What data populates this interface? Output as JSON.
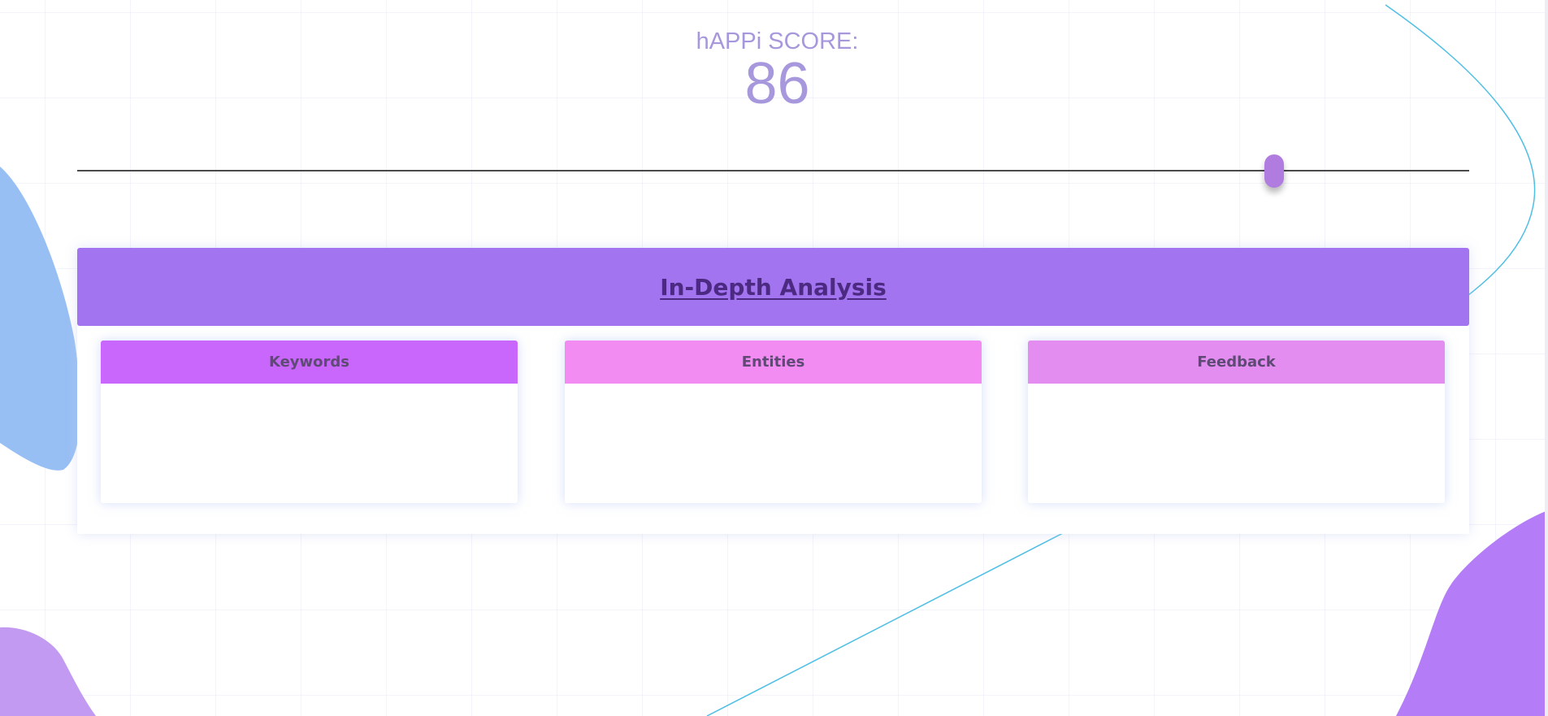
{
  "score": {
    "label": "hAPPi SCORE:",
    "value": "86"
  },
  "slider": {
    "value": 86,
    "min": 0,
    "max": 100
  },
  "analysis": {
    "title": "In-Depth Analysis",
    "cards": [
      {
        "label": "Keywords",
        "color": "#c966fb"
      },
      {
        "label": "Entities",
        "color": "#f28bf2"
      },
      {
        "label": "Feedback",
        "color": "#e38df0"
      }
    ]
  },
  "colors": {
    "score_text": "#a797dc",
    "header": "#a374f0",
    "slider_thumb": "#b07cdf",
    "blob_blue": "#97bff4",
    "blob_purple": "#b47cf6",
    "curve": "#4fbfe5"
  }
}
